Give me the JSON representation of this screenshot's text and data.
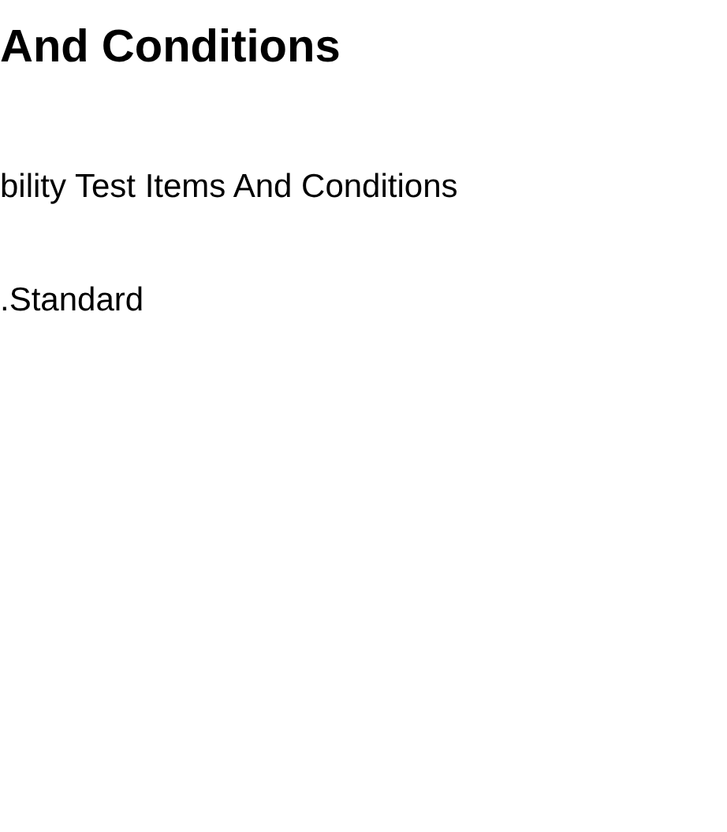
{
  "heading": "And Conditions",
  "paragraphs": [
    "bility Test Items And Conditions",
    ".Standard"
  ]
}
